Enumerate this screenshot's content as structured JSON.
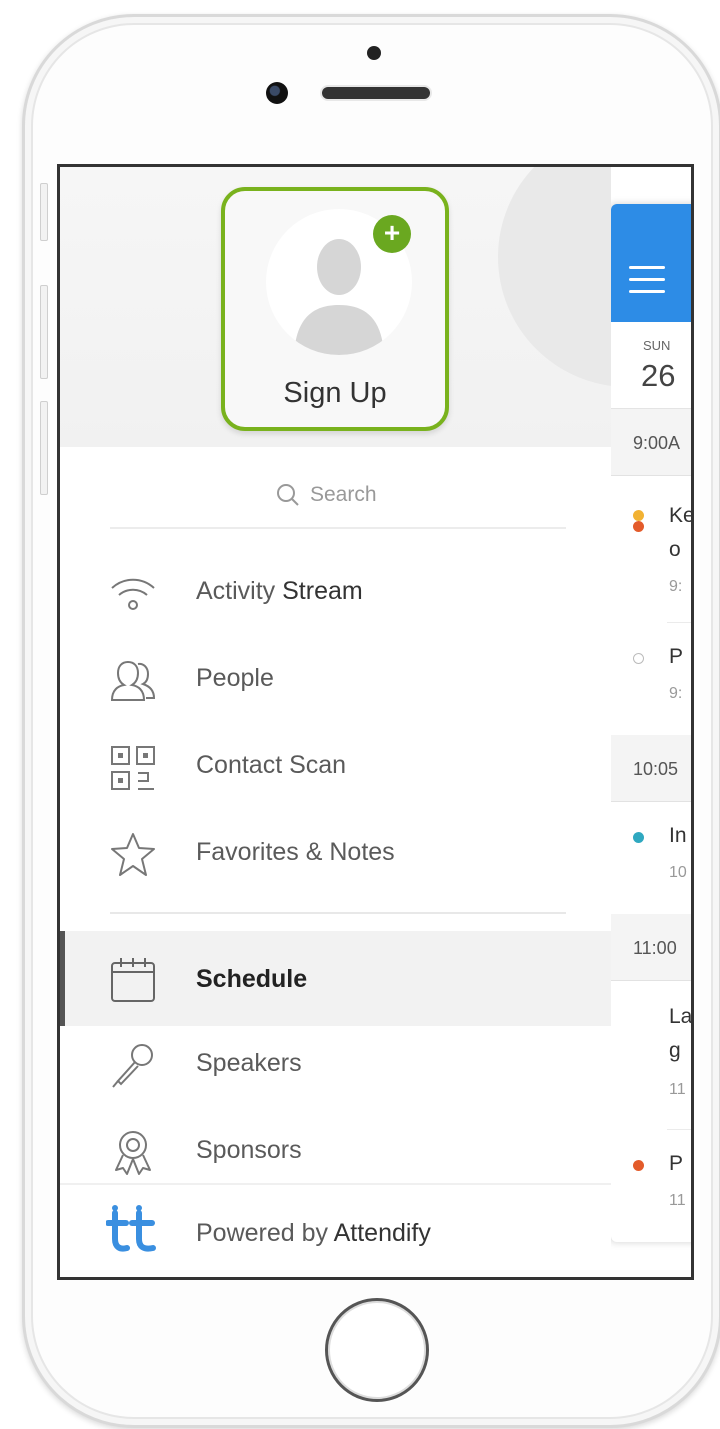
{
  "profile": {
    "signup_label": "Sign Up",
    "plus": "+"
  },
  "search": {
    "placeholder": "Search"
  },
  "menu": {
    "activity": {
      "label_a": "Activity",
      "label_b": " Stream",
      "icon": "wifi-icon"
    },
    "people": {
      "label": "People",
      "icon": "people-icon"
    },
    "contact_scan": {
      "label": "Contact Scan",
      "icon": "qr-code-icon"
    },
    "favorites": {
      "label": "Favorites & Notes",
      "icon": "star-icon"
    },
    "schedule": {
      "label": "Schedule",
      "icon": "calendar-icon",
      "active": true
    },
    "speakers": {
      "label": "Speakers",
      "icon": "microphone-icon"
    },
    "sponsors": {
      "label": "Sponsors",
      "icon": "award-ribbon-icon"
    }
  },
  "footer": {
    "prefix": "Powered by ",
    "brand": "Attendify"
  },
  "schedule": {
    "day": {
      "dow": "SUN",
      "num": "26"
    },
    "times": [
      "9:00A",
      "10:05",
      "11:00"
    ],
    "items": [
      {
        "line1": "Ke",
        "line2": "o",
        "sub": "9:"
      },
      {
        "line1": "P",
        "sub": "9:"
      },
      {
        "line1": "In",
        "sub": "10"
      },
      {
        "line1": "La",
        "line2": "g",
        "sub": "11"
      },
      {
        "line1": "P",
        "sub": "11"
      }
    ]
  },
  "colors": {
    "accent_green": "#79b21d",
    "header_blue": "#2d8ce6",
    "logo_blue": "#3a8fe0"
  }
}
